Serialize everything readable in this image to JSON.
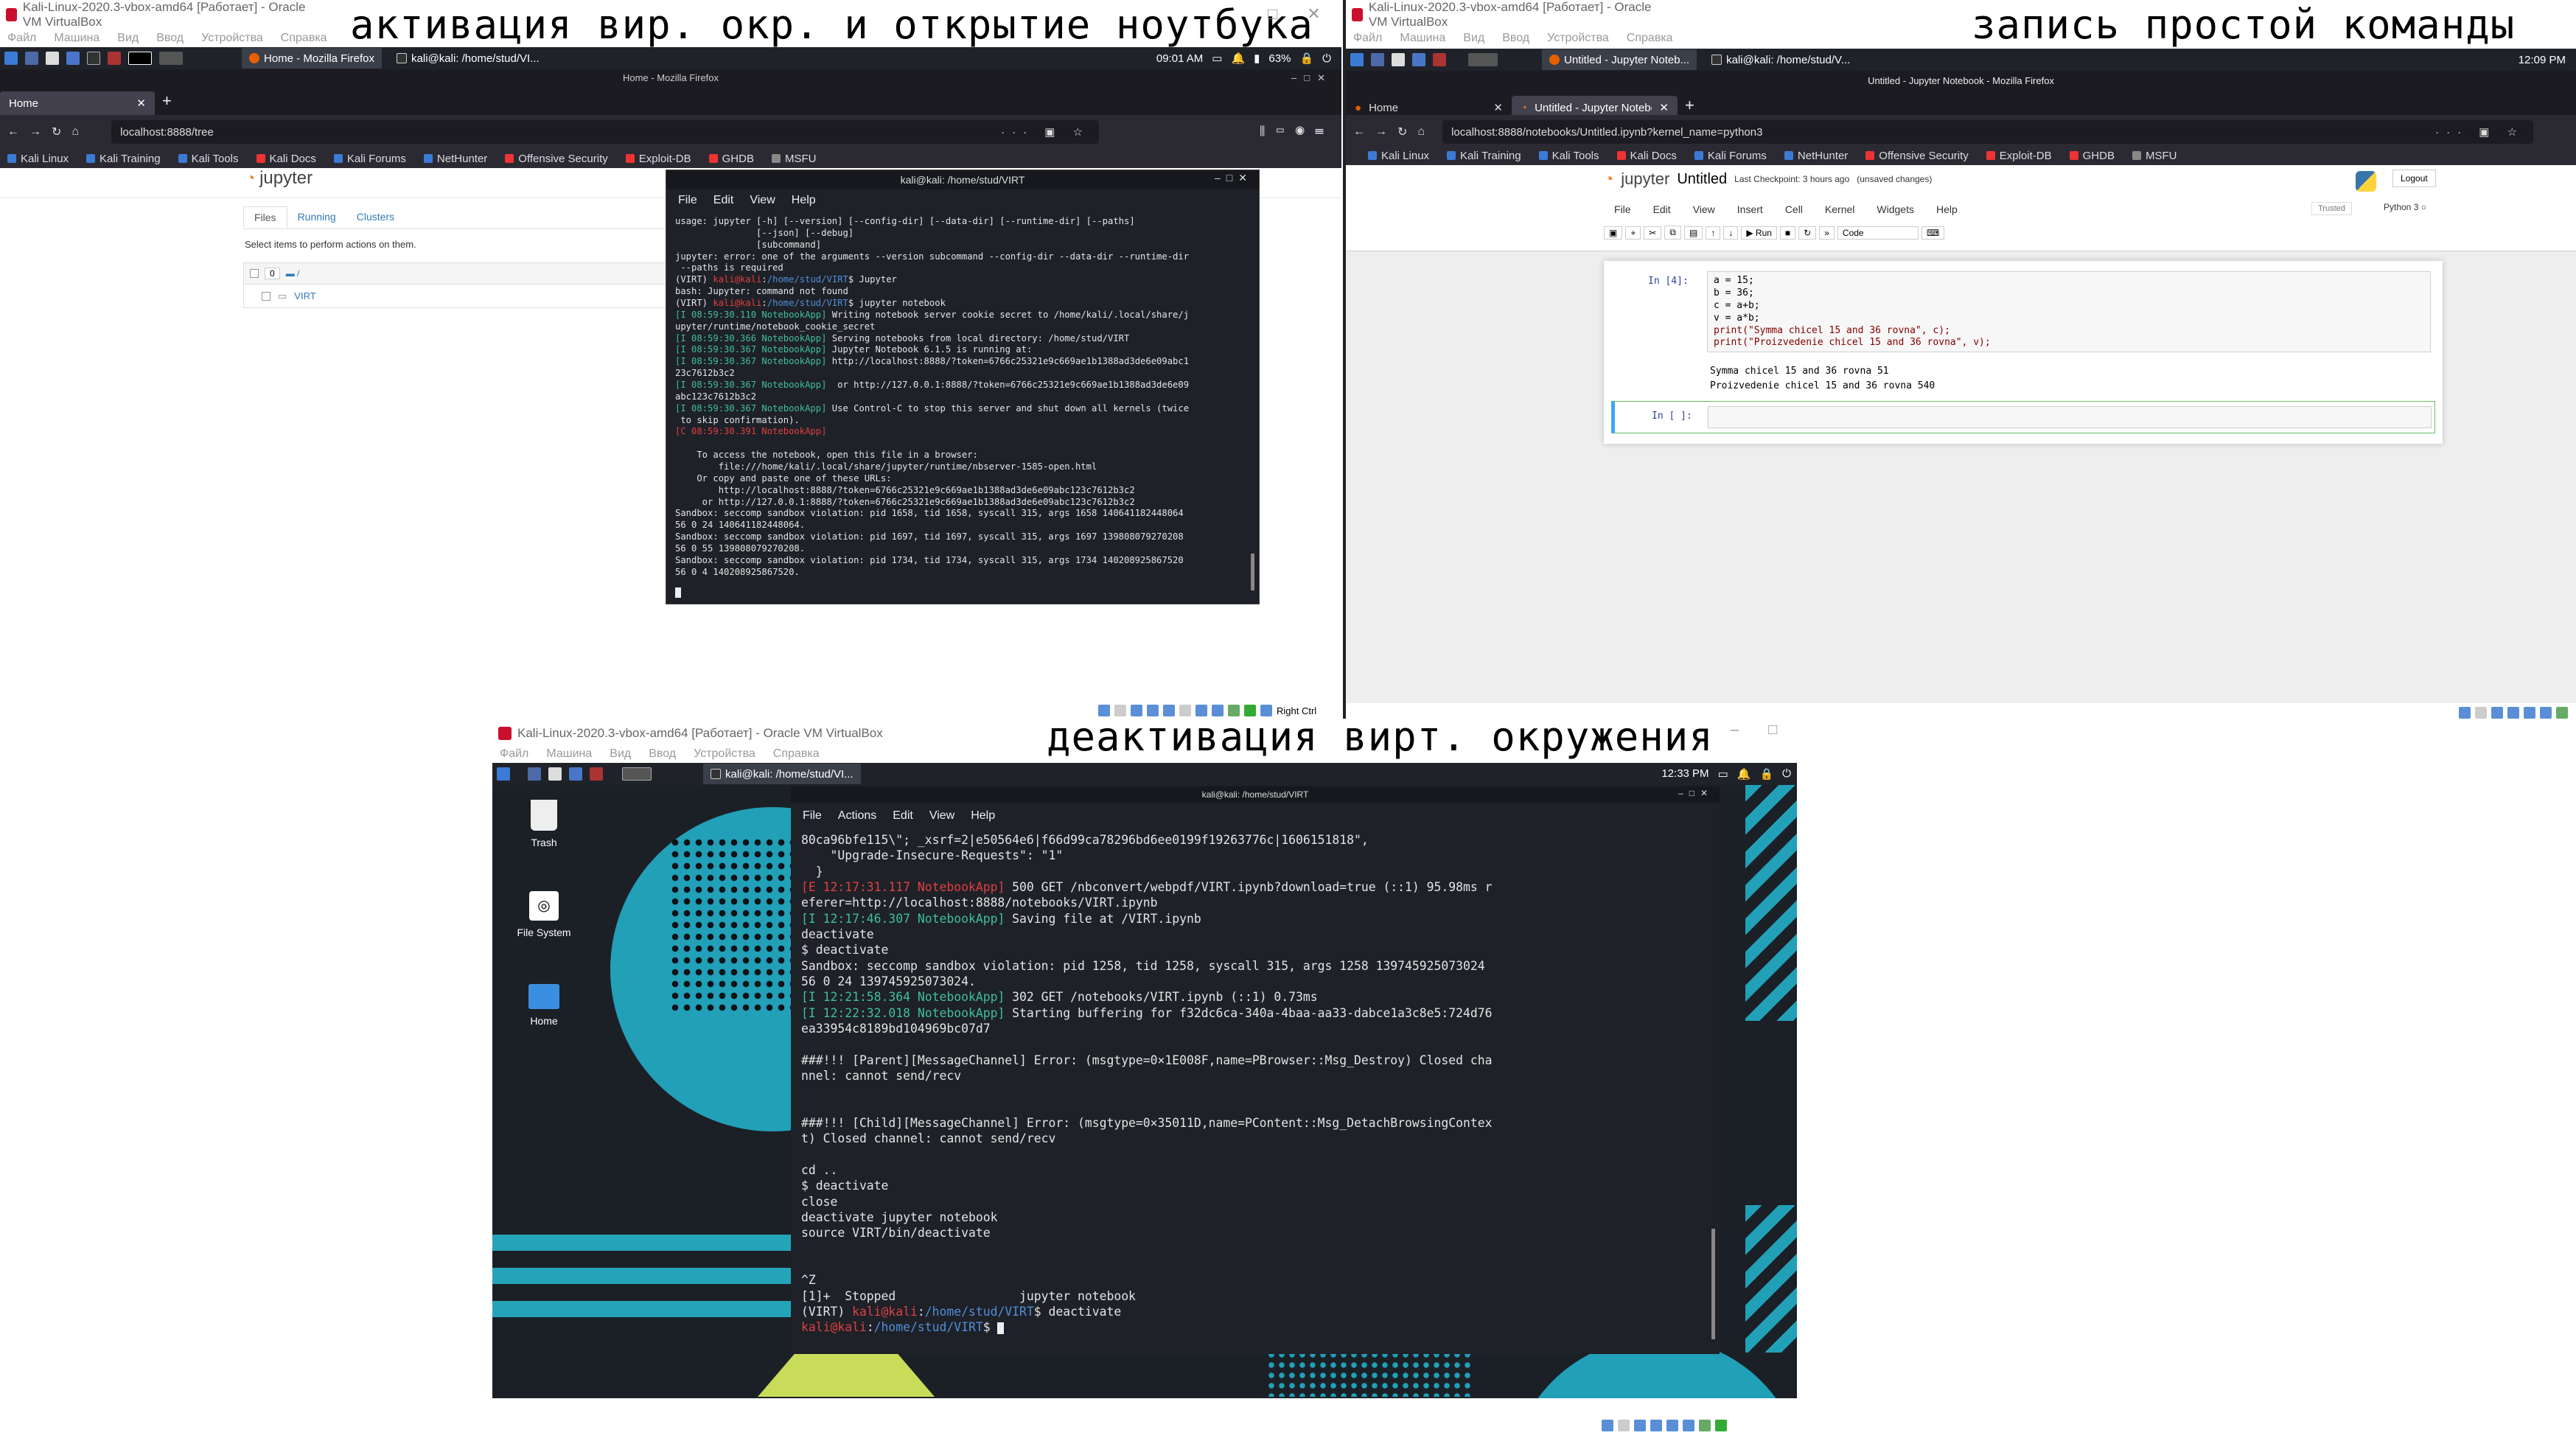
{
  "captions": {
    "top_left": "активация вир. окр. и открытие ноутбука",
    "top_right": "запись простой команды",
    "bottom": "деактивация вирт. окружения"
  },
  "vbox": {
    "title_tl": "Kali-Linux-2020.3-vbox-amd64 [Работает] - Oracle VM VirtualBox",
    "title_tr": "Kali-Linux-2020.3-vbox-amd64 [Работает] - Oracle VM VirtualBox",
    "title_b": "Kali-Linux-2020.3-vbox-amd64 [Работает] - Oracle VM VirtualBox",
    "menu": [
      "Файл",
      "Машина",
      "Вид",
      "Ввод",
      "Устройства",
      "Справка"
    ],
    "host_key": "Right Ctrl"
  },
  "tl": {
    "panel_task1": "Home - Mozilla Firefox",
    "panel_task2": "kali@kali: /home/stud/VI...",
    "time": "09:01 AM",
    "battery": "63%",
    "fx_window_title": "Home - Mozilla Firefox",
    "tab_label": "Home",
    "url": "localhost:8888/tree",
    "bookmarks": [
      "Kali Linux",
      "Kali Training",
      "Kali Tools",
      "Kali Docs",
      "Kali Forums",
      "NetHunter",
      "Offensive Security",
      "Exploit-DB",
      "GHDB",
      "MSFU"
    ],
    "jupyter_logo": "jupyter",
    "tabs": [
      "Files",
      "Running",
      "Clusters"
    ],
    "select_hint": "Select items to perform actions on them.",
    "count": "0",
    "folder": "VIRT",
    "term_title": "kali@kali: /home/stud/VIRT",
    "term_menu": [
      "File",
      "Edit",
      "View",
      "Help"
    ]
  },
  "tl_term_lines": [
    {
      "t": "usage: jupyter [-h] [--version] [--config-dir] [--data-dir] [--runtime-dir] [--paths]",
      "c": ""
    },
    {
      "t": "               [--json] [--debug]",
      "c": ""
    },
    {
      "t": "               [subcommand]",
      "c": ""
    },
    {
      "t": "jupyter: error: one of the arguments --version subcommand --config-dir --data-dir --runtime-dir",
      "c": ""
    },
    {
      "t": " --paths is required",
      "c": ""
    },
    {
      "t": "(VIRT) kali@kali:/home/stud/VIRT$ Jupyter",
      "c": "prompt"
    },
    {
      "t": "bash: Jupyter: command not found",
      "c": ""
    },
    {
      "t": "(VIRT) kali@kali:/home/stud/VIRT$ jupyter notebook",
      "c": "prompt"
    },
    {
      "t": "[I 08:59:30.110 NotebookApp] Writing notebook server cookie secret to /home/kali/.local/share/j",
      "c": "log"
    },
    {
      "t": "upyter/runtime/notebook_cookie_secret",
      "c": ""
    },
    {
      "t": "[I 08:59:30.366 NotebookApp] Serving notebooks from local directory: /home/stud/VIRT",
      "c": "log"
    },
    {
      "t": "[I 08:59:30.367 NotebookApp] Jupyter Notebook 6.1.5 is running at:",
      "c": "log"
    },
    {
      "t": "[I 08:59:30.367 NotebookApp] http://localhost:8888/?token=6766c25321e9c669ae1b1388ad3de6e09abc1",
      "c": "log"
    },
    {
      "t": "23c7612b3c2",
      "c": ""
    },
    {
      "t": "[I 08:59:30.367 NotebookApp]  or http://127.0.0.1:8888/?token=6766c25321e9c669ae1b1388ad3de6e09",
      "c": "log"
    },
    {
      "t": "abc123c7612b3c2",
      "c": ""
    },
    {
      "t": "[I 08:59:30.367 NotebookApp] Use Control-C to stop this server and shut down all kernels (twice",
      "c": "log"
    },
    {
      "t": " to skip confirmation).",
      "c": ""
    },
    {
      "t": "[C 08:59:30.391 NotebookApp]",
      "c": "logc"
    },
    {
      "t": "",
      "c": ""
    },
    {
      "t": "    To access the notebook, open this file in a browser:",
      "c": ""
    },
    {
      "t": "        file:///home/kali/.local/share/jupyter/runtime/nbserver-1585-open.html",
      "c": ""
    },
    {
      "t": "    Or copy and paste one of these URLs:",
      "c": ""
    },
    {
      "t": "        http://localhost:8888/?token=6766c25321e9c669ae1b1388ad3de6e09abc123c7612b3c2",
      "c": ""
    },
    {
      "t": "     or http://127.0.0.1:8888/?token=6766c25321e9c669ae1b1388ad3de6e09abc123c7612b3c2",
      "c": ""
    },
    {
      "t": "Sandbox: seccomp sandbox violation: pid 1658, tid 1658, syscall 315, args 1658 140641182448064",
      "c": ""
    },
    {
      "t": "56 0 24 140641182448064.",
      "c": ""
    },
    {
      "t": "Sandbox: seccomp sandbox violation: pid 1697, tid 1697, syscall 315, args 1697 139808079270208",
      "c": ""
    },
    {
      "t": "56 0 55 139808079270208.",
      "c": ""
    },
    {
      "t": "Sandbox: seccomp sandbox violation: pid 1734, tid 1734, syscall 315, args 1734 140208925867520",
      "c": ""
    },
    {
      "t": "56 0 4 140208925867520.",
      "c": ""
    }
  ],
  "tr": {
    "panel_task1": "Untitled - Jupyter Noteb...",
    "panel_task2": "kali@kali: /home/stud/V...",
    "time": "12:09 PM",
    "fx_window_title": "Untitled - Jupyter Notebook - Mozilla Firefox",
    "tab1": "Home",
    "tab2": "Untitled - Jupyter Notebo",
    "url": "localhost:8888/notebooks/Untitled.ipynb?kernel_name=python3",
    "nb_title": "Untitled",
    "checkpoint": "Last Checkpoint: 3 hours ago",
    "unsaved": "(unsaved changes)",
    "logout": "Logout",
    "menu": [
      "File",
      "Edit",
      "View",
      "Insert",
      "Cell",
      "Kernel",
      "Widgets",
      "Help"
    ],
    "trusted": "Trusted",
    "kernel": "Python 3",
    "run": "Run",
    "cell_type": "Code",
    "in4": "In [4]:",
    "in_empty": "In [ ]:",
    "code": [
      "a = 15;",
      "b = 36;",
      "c = a+b;",
      "v = a*b;"
    ],
    "print1": "print(\"Symma chicel 15 and 36 rovna\", c);",
    "print2": "print(\"Proizvedenie chicel 15 and 36 rovna\", v);",
    "out1": "Symma chicel 15 and 36 rovna 51",
    "out2": "Proizvedenie chicel 15 and 36 rovna 540"
  },
  "b": {
    "panel_task": "kali@kali: /home/stud/VI...",
    "time": "12:33 PM",
    "desktop_icons": [
      "Trash",
      "File System",
      "Home"
    ],
    "term_title": "kali@kali: /home/stud/VIRT",
    "term_menu": [
      "File",
      "Actions",
      "Edit",
      "View",
      "Help"
    ]
  },
  "b_term_lines": [
    {
      "t": "80ca96bfe115\\\"; _xsrf=2|e50564e6|f66d99ca78296bd6ee0199f19263776c|1606151818\",",
      "c": ""
    },
    {
      "t": "    \"Upgrade-Insecure-Requests\": \"1\"",
      "c": ""
    },
    {
      "t": "  }",
      "c": ""
    },
    {
      "t": "[E 12:17:31.117 NotebookApp] 500 GET /nbconvert/webpdf/VIRT.ipynb?download=true (::1) 95.98ms r",
      "c": "loge"
    },
    {
      "t": "eferer=http://localhost:8888/notebooks/VIRT.ipynb",
      "c": ""
    },
    {
      "t": "[I 12:17:46.307 NotebookApp] Saving file at /VIRT.ipynb",
      "c": "log"
    },
    {
      "t": "deactivate",
      "c": ""
    },
    {
      "t": "$ deactivate",
      "c": ""
    },
    {
      "t": "Sandbox: seccomp sandbox violation: pid 1258, tid 1258, syscall 315, args 1258 139745925073024",
      "c": ""
    },
    {
      "t": "56 0 24 139745925073024.",
      "c": ""
    },
    {
      "t": "[I 12:21:58.364 NotebookApp] 302 GET /notebooks/VIRT.ipynb (::1) 0.73ms",
      "c": "log"
    },
    {
      "t": "[I 12:22:32.018 NotebookApp] Starting buffering for f32dc6ca-340a-4baa-aa33-dabce1a3c8e5:724d76",
      "c": "log"
    },
    {
      "t": "ea33954c8189bd104969bc07d7",
      "c": ""
    },
    {
      "t": "",
      "c": ""
    },
    {
      "t": "###!!! [Parent][MessageChannel] Error: (msgtype=0×1E008F,name=PBrowser::Msg_Destroy) Closed cha",
      "c": ""
    },
    {
      "t": "nnel: cannot send/recv",
      "c": ""
    },
    {
      "t": "",
      "c": ""
    },
    {
      "t": "",
      "c": ""
    },
    {
      "t": "###!!! [Child][MessageChannel] Error: (msgtype=0×35011D,name=PContent::Msg_DetachBrowsingContex",
      "c": ""
    },
    {
      "t": "t) Closed channel: cannot send/recv",
      "c": ""
    },
    {
      "t": "",
      "c": ""
    },
    {
      "t": "cd ..",
      "c": ""
    },
    {
      "t": "$ deactivate",
      "c": ""
    },
    {
      "t": "close",
      "c": ""
    },
    {
      "t": "deactivate jupyter notebook",
      "c": ""
    },
    {
      "t": "source VIRT/bin/deactivate",
      "c": ""
    },
    {
      "t": "",
      "c": ""
    },
    {
      "t": "",
      "c": ""
    },
    {
      "t": "^Z",
      "c": ""
    },
    {
      "t": "[1]+  Stopped                 jupyter notebook",
      "c": ""
    },
    {
      "t": "(VIRT) kali@kali:/home/stud/VIRT$ deactivate",
      "c": "prompt"
    },
    {
      "t": "kali@kali:/home/stud/VIRT$ ",
      "c": "prompt2"
    }
  ]
}
